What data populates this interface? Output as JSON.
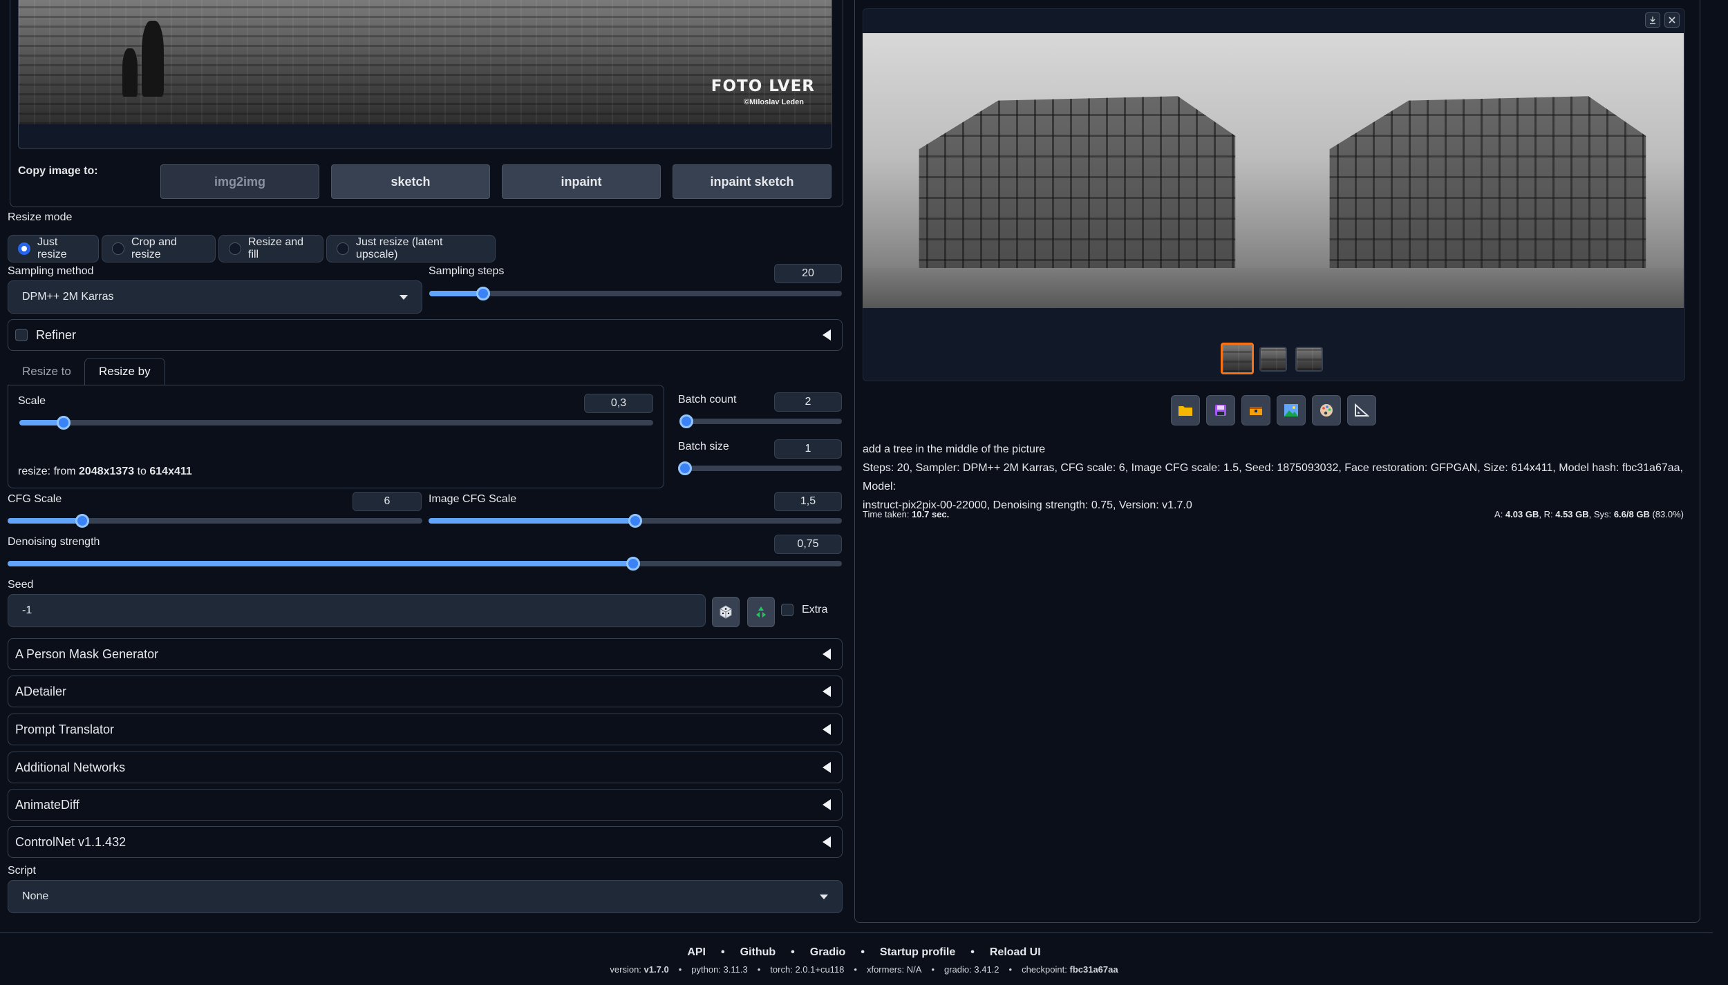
{
  "source_image": {
    "watermark_title": "FOTO LVER",
    "watermark_credit": "©Miloslav Leden"
  },
  "copy_image": {
    "label": "Copy image to:",
    "buttons": [
      "img2img",
      "sketch",
      "inpaint",
      "inpaint sketch"
    ]
  },
  "resize_mode": {
    "label": "Resize mode",
    "options": [
      "Just resize",
      "Crop and resize",
      "Resize and fill",
      "Just resize (latent upscale)"
    ],
    "selected": "Just resize"
  },
  "sampling": {
    "method_label": "Sampling method",
    "method_value": "DPM++ 2M Karras",
    "steps_label": "Sampling steps",
    "steps_value": "20",
    "steps_fraction": 0.13
  },
  "refiner": {
    "label": "Refiner"
  },
  "resize_tabs": {
    "tabs": [
      "Resize to",
      "Resize by"
    ],
    "active": "Resize by"
  },
  "scale": {
    "label": "Scale",
    "value": "0,3",
    "fraction": 0.07,
    "info_prefix": "resize: from",
    "from": "2048x1373",
    "to_word": "to",
    "to": "614x411"
  },
  "batch": {
    "count_label": "Batch count",
    "count_value": "2",
    "count_fraction": 0.0,
    "size_label": "Batch size",
    "size_value": "1",
    "size_fraction": 0.0
  },
  "cfg": {
    "label": "CFG Scale",
    "value": "6",
    "fraction": 0.18,
    "image_label": "Image CFG Scale",
    "image_value": "1,5",
    "image_fraction": 0.5
  },
  "denoising": {
    "label": "Denoising strength",
    "value": "0,75",
    "fraction": 0.75
  },
  "seed": {
    "label": "Seed",
    "value": "-1",
    "extra_label": "Extra"
  },
  "accordions": [
    "A Person Mask Generator",
    "ADetailer",
    "Prompt Translator",
    "Additional Networks",
    "AnimateDiff",
    "ControlNet v1.1.432"
  ],
  "script": {
    "label": "Script",
    "value": "None"
  },
  "gallery": {
    "small_buttons": [
      "download-icon",
      "close-icon"
    ],
    "tool_icons": [
      "folder-icon",
      "save-icon",
      "zip-icon",
      "image-icon",
      "palette-icon",
      "ruler-icon"
    ]
  },
  "generation_info": {
    "prompt": "add a tree in the middle of the picture",
    "params_line1": "Steps: 20, Sampler: DPM++ 2M Karras, CFG scale: 6, Image CFG scale: 1.5, Seed: 1875093032, Face restoration: GFPGAN, Size: 614x411, Model hash: fbc31a67aa, Model:",
    "params_line2": "instruct-pix2pix-00-22000, Denoising strength: 0.75, Version: v1.7.0",
    "time_label": "Time taken:",
    "time_value": "10.7 sec.",
    "mem_a_label": "A:",
    "mem_a": "4.03 GB",
    "mem_r_label": "R:",
    "mem_r": "4.53 GB",
    "mem_sys_label": "Sys:",
    "mem_sys": "6.6/8 GB",
    "mem_pct": "(83.0%)"
  },
  "footer": {
    "links": [
      "API",
      "Github",
      "Gradio",
      "Startup profile",
      "Reload UI"
    ],
    "version_label": "version:",
    "version": "v1.7.0",
    "python_label": "python:",
    "python": "3.11.3",
    "torch_label": "torch:",
    "torch": "2.0.1+cu118",
    "xformers_label": "xformers:",
    "xformers": "N/A",
    "gradio_label": "gradio:",
    "gradio": "3.41.2",
    "checkpoint_label": "checkpoint:",
    "checkpoint": "fbc31a67aa"
  },
  "colors": {
    "background": "#0b0f19",
    "panel_border": "#374151",
    "accent_blue": "#3b82f6",
    "selected_thumb": "#f97316"
  }
}
